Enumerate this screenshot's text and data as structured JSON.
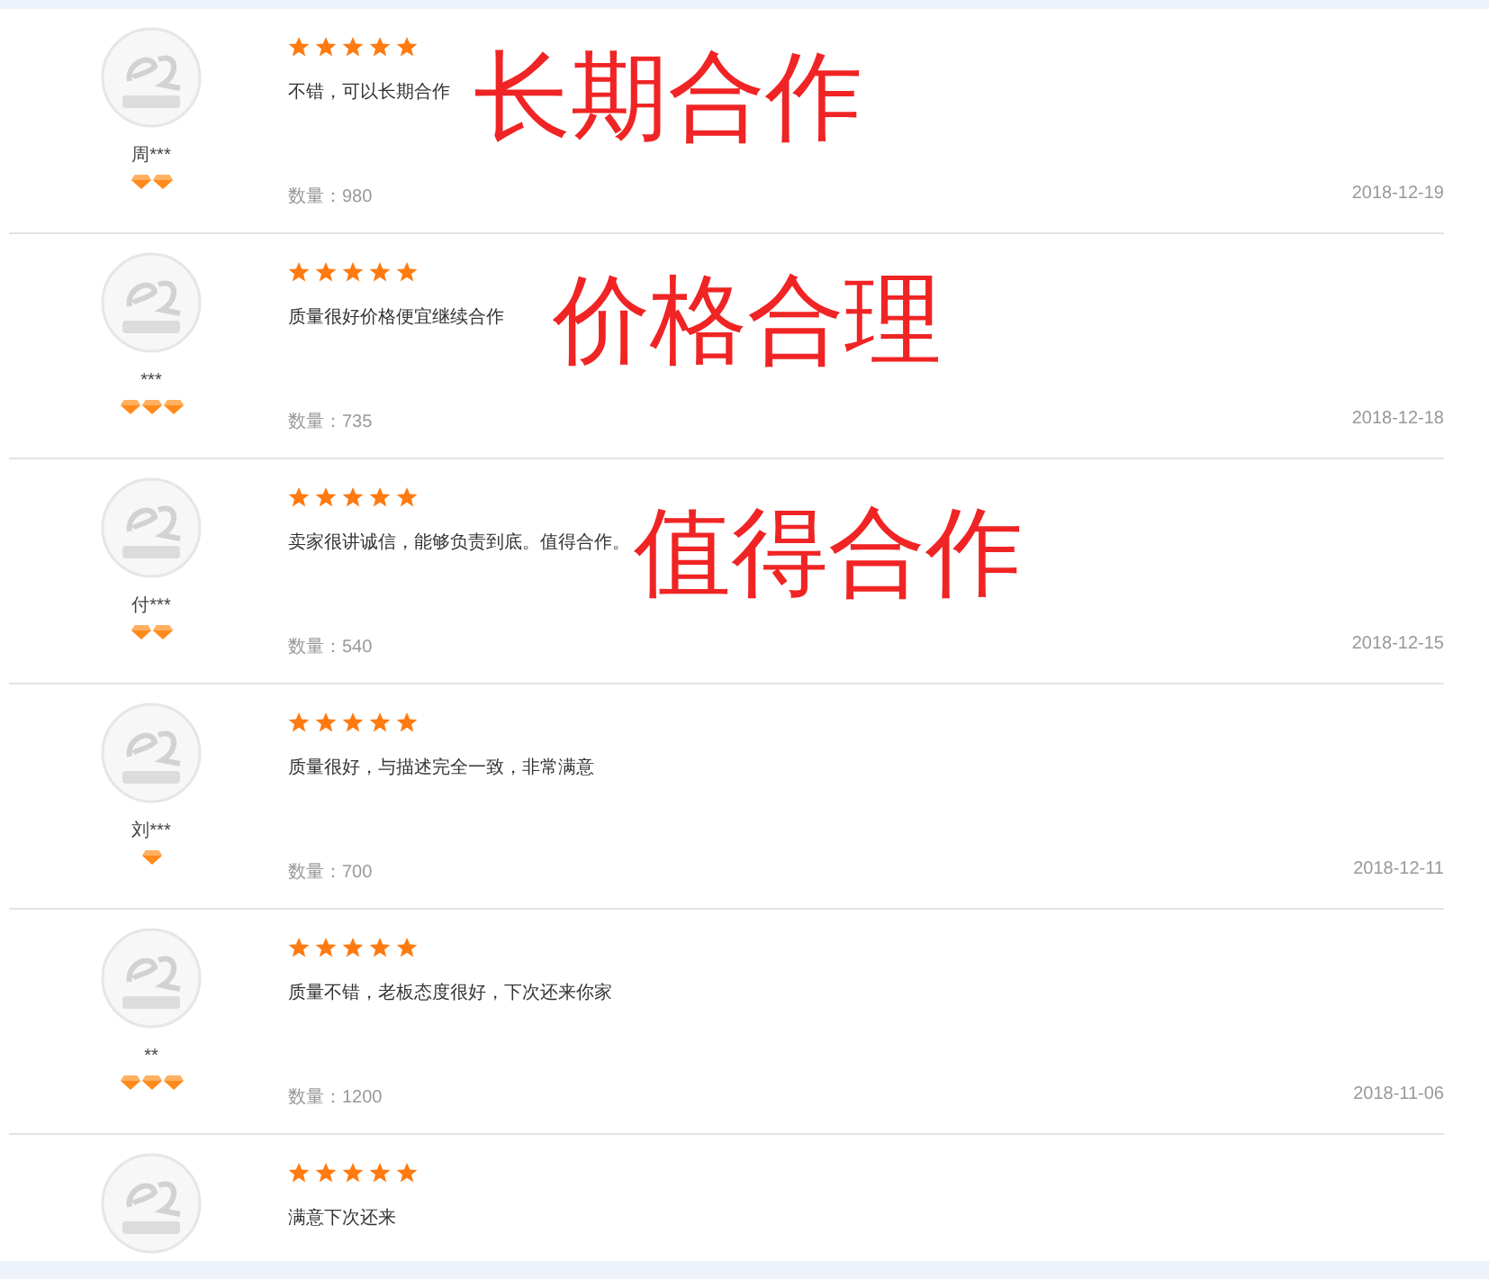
{
  "reviews": [
    {
      "user": "周***",
      "badges": [
        {
          "kind": "diamond"
        },
        {
          "kind": "diamond"
        }
      ],
      "stars": 5,
      "comment": "不错，可以长期合作",
      "quantity": "数量：980",
      "date": "2018-12-19",
      "annotation": "长期合作"
    },
    {
      "user": "***",
      "badges": [
        {
          "kind": "diamond"
        },
        {
          "kind": "diamond"
        },
        {
          "kind": "diamond"
        }
      ],
      "stars": 5,
      "comment": "质量很好价格便宜继续合作",
      "quantity": "数量：735",
      "date": "2018-12-18",
      "annotation": "价格合理"
    },
    {
      "user": "付***",
      "badges": [
        {
          "kind": "diamond"
        },
        {
          "kind": "diamond"
        }
      ],
      "stars": 5,
      "comment": "卖家很讲诚信，能够负责到底。值得合作。",
      "quantity": "数量：540",
      "date": "2018-12-15",
      "annotation": "值得合作"
    },
    {
      "user": "刘***",
      "badges": [
        {
          "kind": "diamond"
        }
      ],
      "stars": 5,
      "comment": "质量很好，与描述完全一致，非常满意",
      "quantity": "数量：700",
      "date": "2018-12-11"
    },
    {
      "user": "**",
      "badges": [
        {
          "kind": "diamond"
        },
        {
          "kind": "diamond"
        },
        {
          "kind": "diamond"
        }
      ],
      "stars": 5,
      "comment": "质量不错，老板态度很好，下次还来你家",
      "quantity": "数量：1200",
      "date": "2018-11-06"
    },
    {
      "stars": 5,
      "comment": "满意下次还来"
    }
  ]
}
